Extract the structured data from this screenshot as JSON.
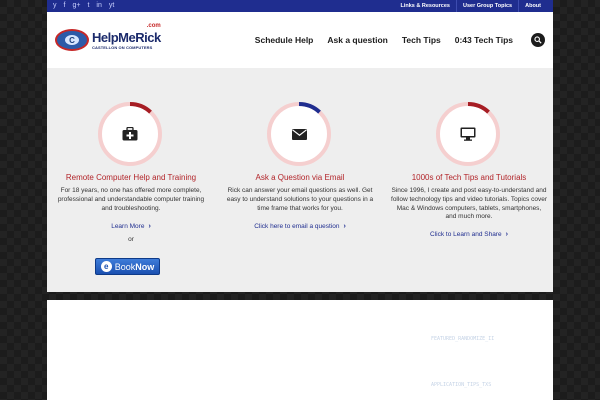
{
  "topbar": {
    "social": [
      "y",
      "f",
      "g+",
      "t",
      "in",
      "yt"
    ],
    "links": [
      "Links & Resources",
      "User Group Topics",
      "About"
    ]
  },
  "header": {
    "logo": {
      "name_part1": "HelpMe",
      "name_part2": "Rick",
      "dotcom": ".com",
      "tagline": "CASTELLON ON COMPUTERS"
    },
    "nav": [
      "Schedule Help",
      "Ask a question",
      "Tech Tips",
      "0:43 Tech Tips"
    ]
  },
  "columns": [
    {
      "icon": "first-aid-kit-icon",
      "title": "Remote Computer Help and Training",
      "body": "For 18 years, no one has offered more complete, professional and understandable computer training and troubleshooting.",
      "link": "Learn More",
      "or": "or",
      "book_label_1": "Book",
      "book_label_2": "Now",
      "ring_color": "#a61d24",
      "ring_fraction": 0.12
    },
    {
      "icon": "envelope-icon",
      "title": "Ask a Question via Email",
      "body": "Rick can answer your email questions as well. Get easy to understand solutions to your questions in a time frame that works for you.",
      "link": "Click here to email a question",
      "ring_color": "#1f2d8f",
      "ring_fraction": 0.12
    },
    {
      "icon": "monitor-icon",
      "title": "1000s of Tech Tips and Tutorials",
      "body": "Since 1996, I create and post easy-to-understand and follow technology tips and video tutorials. Topics cover Mac & Windows computers, tablets, smartphones, and much more.",
      "link": "Click to Learn and Share",
      "ring_color": "#a61d24",
      "ring_fraction": 0.12
    }
  ],
  "lower": {
    "tags": [
      "FEATURED_RANDOMIZE_II",
      "APPLICATION_TIPS_TXS"
    ]
  },
  "colors": {
    "accent_red": "#b2252a",
    "accent_blue": "#1f2d8f",
    "ring_bg": "#f5c8c8"
  }
}
